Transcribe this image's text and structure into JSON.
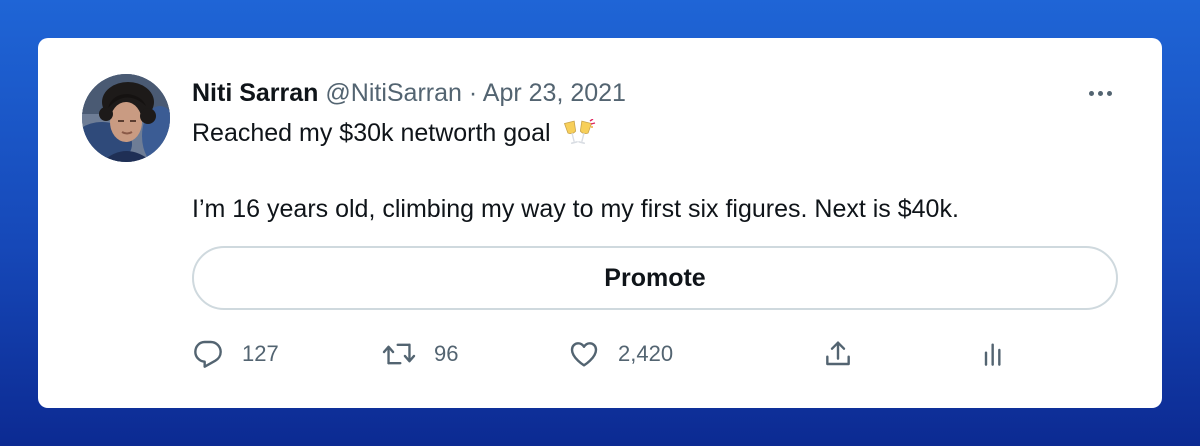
{
  "tweet": {
    "author_name": "Niti Sarran",
    "handle": "@NitiSarran",
    "separator": "·",
    "date": "Apr 23, 2021",
    "line1": "Reached my $30k networth goal",
    "line1_emoji": "clinking-glasses-icon",
    "line2": "I’m 16 years old, climbing my way to my first six figures. Next is $40k."
  },
  "promote_label": "Promote",
  "actions": {
    "reply": {
      "icon": "reply-icon",
      "count": "127"
    },
    "retweet": {
      "icon": "retweet-icon",
      "count": "96"
    },
    "like": {
      "icon": "heart-icon",
      "count": "2,420"
    },
    "share": {
      "icon": "share-icon"
    },
    "analytics": {
      "icon": "analytics-icon"
    }
  },
  "colors": {
    "background_top": "#1f65d6",
    "background_bottom": "#0c2a92",
    "text_primary": "#0f1419",
    "text_secondary": "#536471",
    "border": "#cfd9de"
  }
}
